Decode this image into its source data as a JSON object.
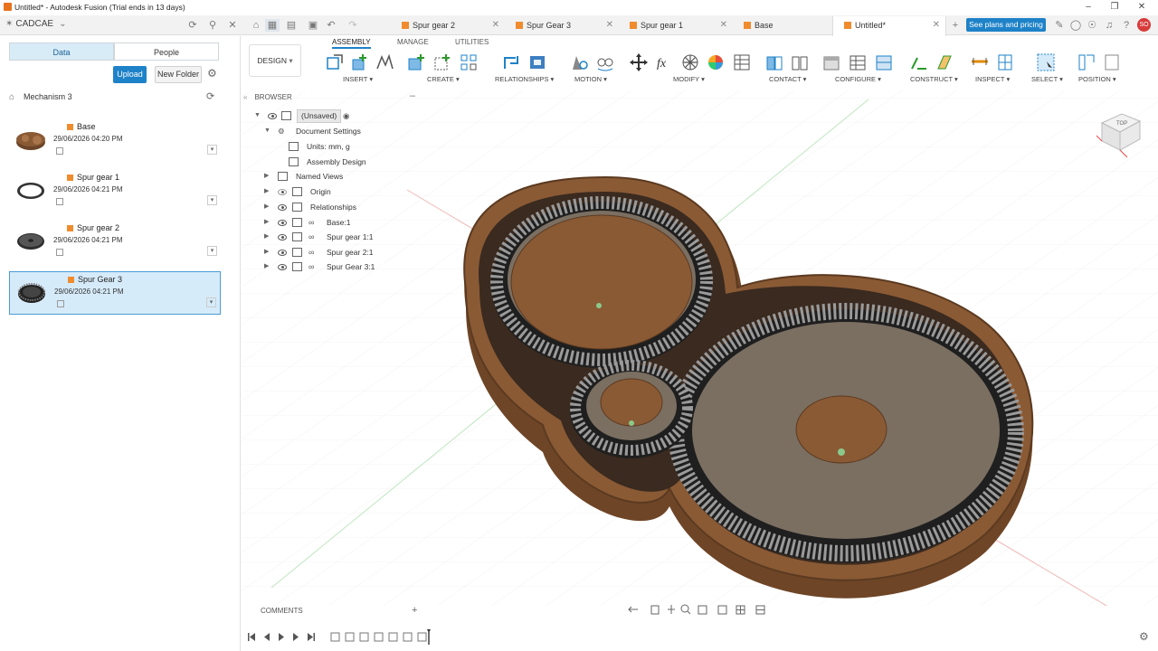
{
  "window": {
    "title": "Untitled* - Autodesk Fusion (Trial ends in 13 days)"
  },
  "team": {
    "name": "CADCAE"
  },
  "tabs": [
    {
      "label": "Spur gear 2"
    },
    {
      "label": "Spur Gear 3"
    },
    {
      "label": "Spur gear 1"
    },
    {
      "label": "Base"
    },
    {
      "label": "Untitled*"
    }
  ],
  "header": {
    "plans_label": "See plans and pricing",
    "user_initials": "SO"
  },
  "data_panel": {
    "tab_data": "Data",
    "tab_people": "People",
    "upload_label": "Upload",
    "new_folder_label": "New Folder",
    "breadcrumb": "Mechanism 3",
    "items": [
      {
        "name": "Base",
        "date": "29/06/2026 04:20 PM"
      },
      {
        "name": "Spur gear 1",
        "date": "29/06/2026 04:21 PM"
      },
      {
        "name": "Spur gear 2",
        "date": "29/06/2026 04:21 PM"
      },
      {
        "name": "Spur Gear 3",
        "date": "29/06/2026 04:21 PM"
      }
    ]
  },
  "toolbar": {
    "workspace": "DESIGN",
    "tabs": [
      "ASSEMBLY",
      "MANAGE",
      "UTILITIES"
    ],
    "groups": {
      "insert": "INSERT",
      "create": "CREATE",
      "relationships": "RELATIONSHIPS",
      "motion": "MOTION",
      "modify": "MODIFY",
      "contact": "CONTACT",
      "configure": "CONFIGURE",
      "construct": "CONSTRUCT",
      "inspect": "INSPECT",
      "select": "SELECT",
      "position": "POSITION"
    }
  },
  "browser": {
    "title": "BROWSER",
    "root": "(Unsaved)",
    "nodes": {
      "doc_settings": "Document Settings",
      "units": "Units: mm, g",
      "assembly_design": "Assembly Design",
      "named_views": "Named Views",
      "origin": "Origin",
      "relationships": "Relationships",
      "base": "Base:1",
      "spur1": "Spur gear 1:1",
      "spur2": "Spur gear 2:1",
      "spur3": "Spur Gear 3:1"
    }
  },
  "viewcube": {
    "face": "TOP"
  },
  "comments": {
    "label": "COMMENTS"
  },
  "colors": {
    "accent": "#1e82c8",
    "gear_brown": "#8a5a35",
    "doc_orange": "#f08c2e"
  }
}
